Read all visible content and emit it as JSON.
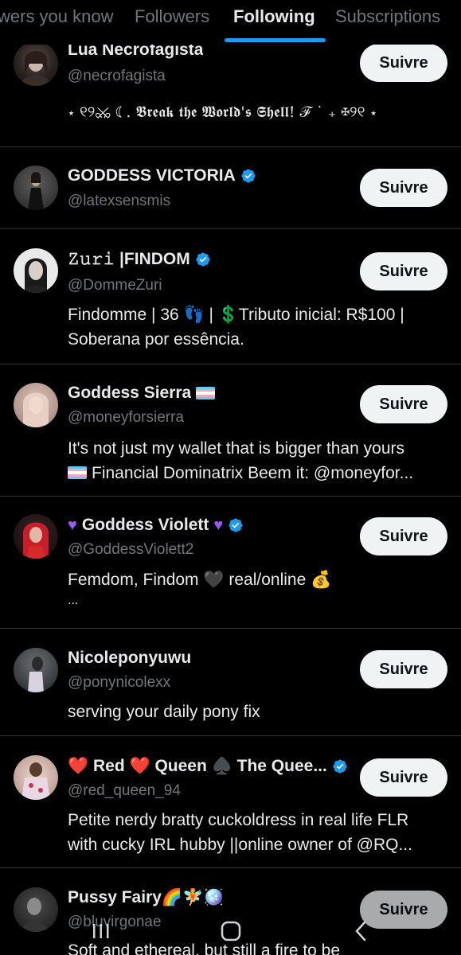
{
  "tabs": [
    {
      "label": "wers you know"
    },
    {
      "label": "Followers"
    },
    {
      "label": "Following",
      "active": true
    },
    {
      "label": "Subscriptions"
    }
  ],
  "follow_label": "Suivre",
  "accounts": [
    {
      "name": "Lua Necrofagista",
      "handle": "@necrofagista",
      "verified": false,
      "bio": [
        "⋆ ୧୨⚔ ☾. 𝕭𝖗𝖊𝖆𝖐 𝖙𝖍𝖊 𝖂𝖔𝖗𝖑𝖉'𝖘 𝕾𝖍𝖊𝖑𝖑! ℱ ˙ ₊ ✠୨୧ ⋆"
      ]
    },
    {
      "name": "GODDESS VICTORIA",
      "handle": "@latexsensmis",
      "verified": true,
      "bio": []
    },
    {
      "name": "𝚉𝚞𝚛𝚒 |FINDOM",
      "handle": "@DommeZuri",
      "verified": true,
      "bio": [
        "Findomme | 36 👣 | 💲Tributo inicial: R$100 |",
        "Soberana por essência."
      ]
    },
    {
      "name": "Goddess Sierra",
      "handle": "@moneyforsierra",
      "verified": false,
      "bio": [
        "It's not just my wallet that is bigger than yours",
        "Financial Dominatrix Beem it: @moneyfor..."
      ]
    },
    {
      "name": "Goddess Violett",
      "handle": "@GoddessViolett2",
      "verified": true,
      "bio": [
        "Femdom, Findom 🖤 real/online 💰",
        "..."
      ]
    },
    {
      "name": "Nicoleponyuwu",
      "handle": "@ponynicolexx",
      "verified": false,
      "bio": [
        "serving your daily pony fix"
      ]
    },
    {
      "name": "❤️ Red ❤️ Queen ♠️ The Quee...",
      "handle": "@red_queen_94",
      "verified": true,
      "bio": [
        "Petite nerdy bratty cuckoldress in real life FLR",
        "with cucky IRL hubby ||online owner of @RQ..."
      ]
    },
    {
      "name": "Pussy Fairy🌈🧚🪩",
      "handle": "@bluvirgonae",
      "verified": false,
      "bio": [
        "Soft and ethereal, but still a fire to be"
      ]
    }
  ],
  "colors": {
    "background": "#000000",
    "accent": "#1d9bf0",
    "text": "#e7e9ea",
    "secondary": "#71767b",
    "button": "#eff3f4"
  },
  "icons": {
    "verified": "verified-badge-icon",
    "trans_flag": "trans-flag-icon",
    "heart": "purple-heart-icon",
    "nav": [
      "recent-apps-icon",
      "home-icon",
      "back-icon"
    ]
  }
}
